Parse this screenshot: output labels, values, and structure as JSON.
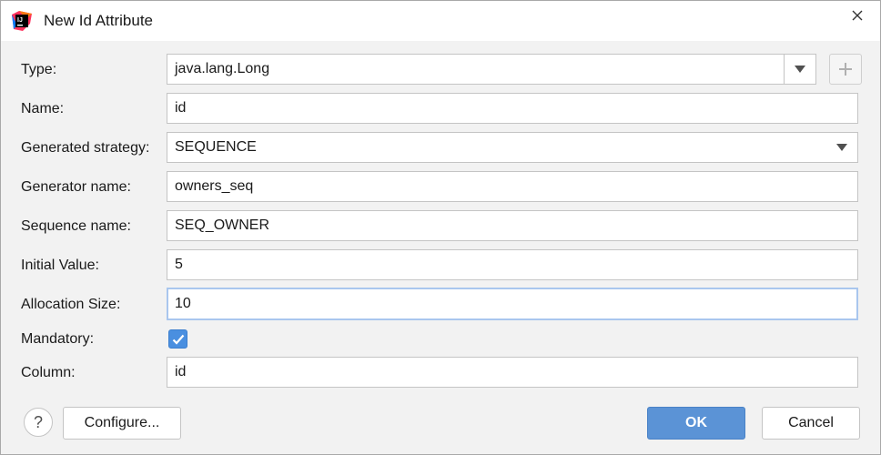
{
  "window": {
    "title": "New Id Attribute",
    "app_icon": "intellij-idea-icon",
    "close_icon": "close-icon"
  },
  "form": {
    "type": {
      "label": "Type:",
      "value": "java.lang.Long"
    },
    "name": {
      "label": "Name:",
      "value": "id"
    },
    "generated_strategy": {
      "label": "Generated strategy:",
      "value": "SEQUENCE"
    },
    "generator_name": {
      "label": "Generator name:",
      "value": "owners_seq"
    },
    "sequence_name": {
      "label": "Sequence name:",
      "value": "SEQ_OWNER"
    },
    "initial_value": {
      "label": "Initial Value:",
      "value": "5"
    },
    "allocation_size": {
      "label": "Allocation Size:",
      "value": "10"
    },
    "mandatory": {
      "label": "Mandatory:",
      "checked": true
    },
    "column": {
      "label": "Column:",
      "value": "id"
    }
  },
  "footer": {
    "help_label": "?",
    "configure_label": "Configure...",
    "ok_label": "OK",
    "cancel_label": "Cancel"
  },
  "colors": {
    "accent": "#5b93d6",
    "checkbox": "#4a8fe0",
    "focus_border": "#a9c6ee"
  }
}
